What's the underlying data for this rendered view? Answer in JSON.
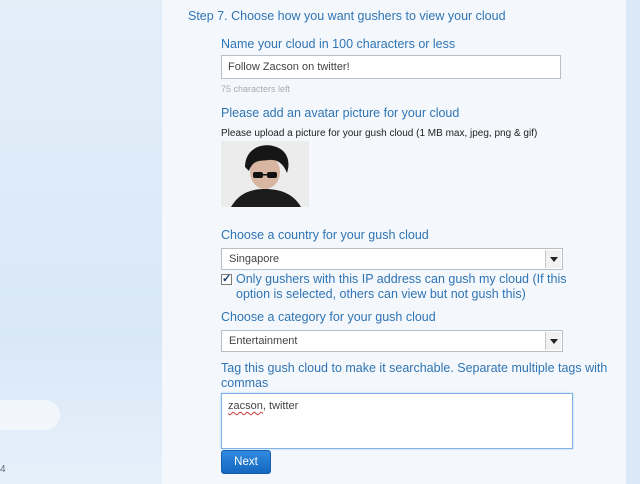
{
  "step_title": "Step 7. Choose how you want gushers to view your cloud",
  "name_section": {
    "label": "Name your cloud in 100 characters or less",
    "input_value": "Follow Zacson on twitter!",
    "chars_left": "75 characters left"
  },
  "avatar_section": {
    "label": "Please add an avatar picture for your cloud",
    "upload_hint": "Please upload a picture for your gush cloud (1 MB max, jpeg, png & gif)"
  },
  "country_section": {
    "label": "Choose a country for your gush cloud",
    "selected": "Singapore",
    "checkbox_checked": true,
    "checkbox_mark": "✓",
    "checkbox_text": "Only gushers with this IP address can gush my cloud (If this option is selected, others can view but not gush this)"
  },
  "category_section": {
    "label": "Choose a category for your gush cloud",
    "selected": "Entertainment"
  },
  "tags_section": {
    "label": "Tag this gush cloud to make it searchable. Separate multiple tags with commas",
    "value_word1": "zacson",
    "value_rest": ", twitter"
  },
  "next_button": "Next",
  "edge_mark": "4"
}
